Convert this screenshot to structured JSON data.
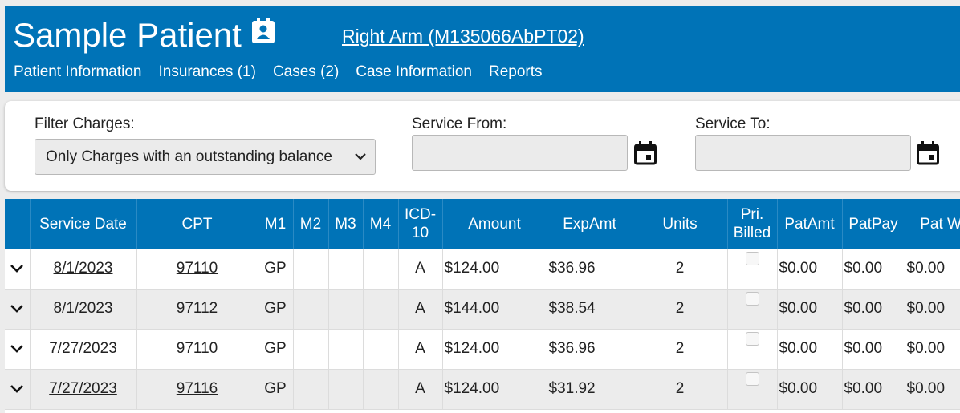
{
  "header": {
    "title": "Sample Patient",
    "contact_icon": "contact-card-icon",
    "case_link": "Right Arm (M135066AbPT02)",
    "nav": [
      "Patient Information",
      "Insurances (1)",
      "Cases (2)",
      "Case Information",
      "Reports"
    ],
    "colors": {
      "primary": "#0073b7"
    }
  },
  "filters": {
    "filter_label": "Filter Charges:",
    "filter_value": "Only Charges with an outstanding balance",
    "service_from_label": "Service From:",
    "service_from_value": "",
    "service_to_label": "Service To:",
    "service_to_value": ""
  },
  "table": {
    "headers": [
      "",
      "Service Date",
      "CPT",
      "M1",
      "M2",
      "M3",
      "M4",
      "ICD-10",
      "Amount",
      "ExpAmt",
      "Units",
      "Pri. Billed",
      "PatAmt",
      "PatPay",
      "Pat W/o"
    ],
    "rows": [
      {
        "date": "8/1/2023",
        "cpt": "97110",
        "m1": "GP",
        "m2": "",
        "m3": "",
        "m4": "",
        "icd": "A",
        "amount": "$124.00",
        "expamt": "$36.96",
        "units": "2",
        "pri_billed": false,
        "patamt": "$0.00",
        "patpay": "$0.00",
        "patwo": "$0.00"
      },
      {
        "date": "8/1/2023",
        "cpt": "97112",
        "m1": "GP",
        "m2": "",
        "m3": "",
        "m4": "",
        "icd": "A",
        "amount": "$144.00",
        "expamt": "$38.54",
        "units": "2",
        "pri_billed": false,
        "patamt": "$0.00",
        "patpay": "$0.00",
        "patwo": "$0.00"
      },
      {
        "date": "7/27/2023",
        "cpt": "97110",
        "m1": "GP",
        "m2": "",
        "m3": "",
        "m4": "",
        "icd": "A",
        "amount": "$124.00",
        "expamt": "$36.96",
        "units": "2",
        "pri_billed": false,
        "patamt": "$0.00",
        "patpay": "$0.00",
        "patwo": "$0.00"
      },
      {
        "date": "7/27/2023",
        "cpt": "97116",
        "m1": "GP",
        "m2": "",
        "m3": "",
        "m4": "",
        "icd": "A",
        "amount": "$124.00",
        "expamt": "$31.92",
        "units": "2",
        "pri_billed": false,
        "patamt": "$0.00",
        "patpay": "$0.00",
        "patwo": "$0.00"
      }
    ]
  }
}
